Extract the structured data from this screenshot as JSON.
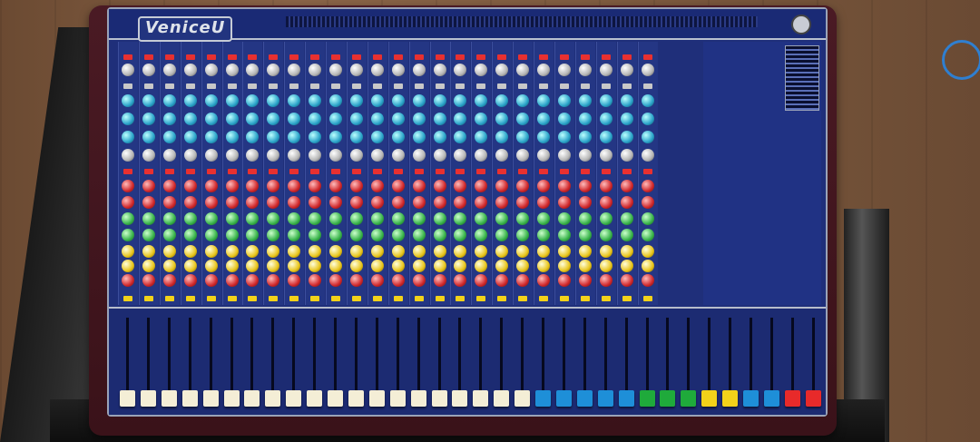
{
  "brand": {
    "logo_text": "VeniceU"
  },
  "channels": {
    "mono_count": 22,
    "stereo_count": 4,
    "fader_cap_colors": [
      "#f4eed6",
      "#f4eed6",
      "#f4eed6",
      "#f4eed6",
      "#f4eed6",
      "#f4eed6",
      "#f4eed6",
      "#f4eed6",
      "#f4eed6",
      "#f4eed6",
      "#f4eed6",
      "#f4eed6",
      "#f4eed6",
      "#f4eed6",
      "#f4eed6",
      "#f4eed6",
      "#f4eed6",
      "#f4eed6",
      "#f4eed6",
      "#f4eed6",
      "#1e8fd8",
      "#1e8fd8",
      "#1e8fd8",
      "#1e8fd8",
      "#1e8fd8",
      "#1faa3b",
      "#1faa3b",
      "#1faa3b",
      "#f2d21a",
      "#f2d21a",
      "#1e8fd8",
      "#1e8fd8",
      "#e82a2a",
      "#e82a2a"
    ]
  },
  "colors": {
    "panel": "#1f2f7a",
    "trim": "#4a1a24",
    "knob_eq": "#2aa3c9",
    "knob_aux_red": "#d0282b",
    "knob_aux_green": "#38b34a",
    "knob_aux_yellow": "#e8c41a"
  }
}
